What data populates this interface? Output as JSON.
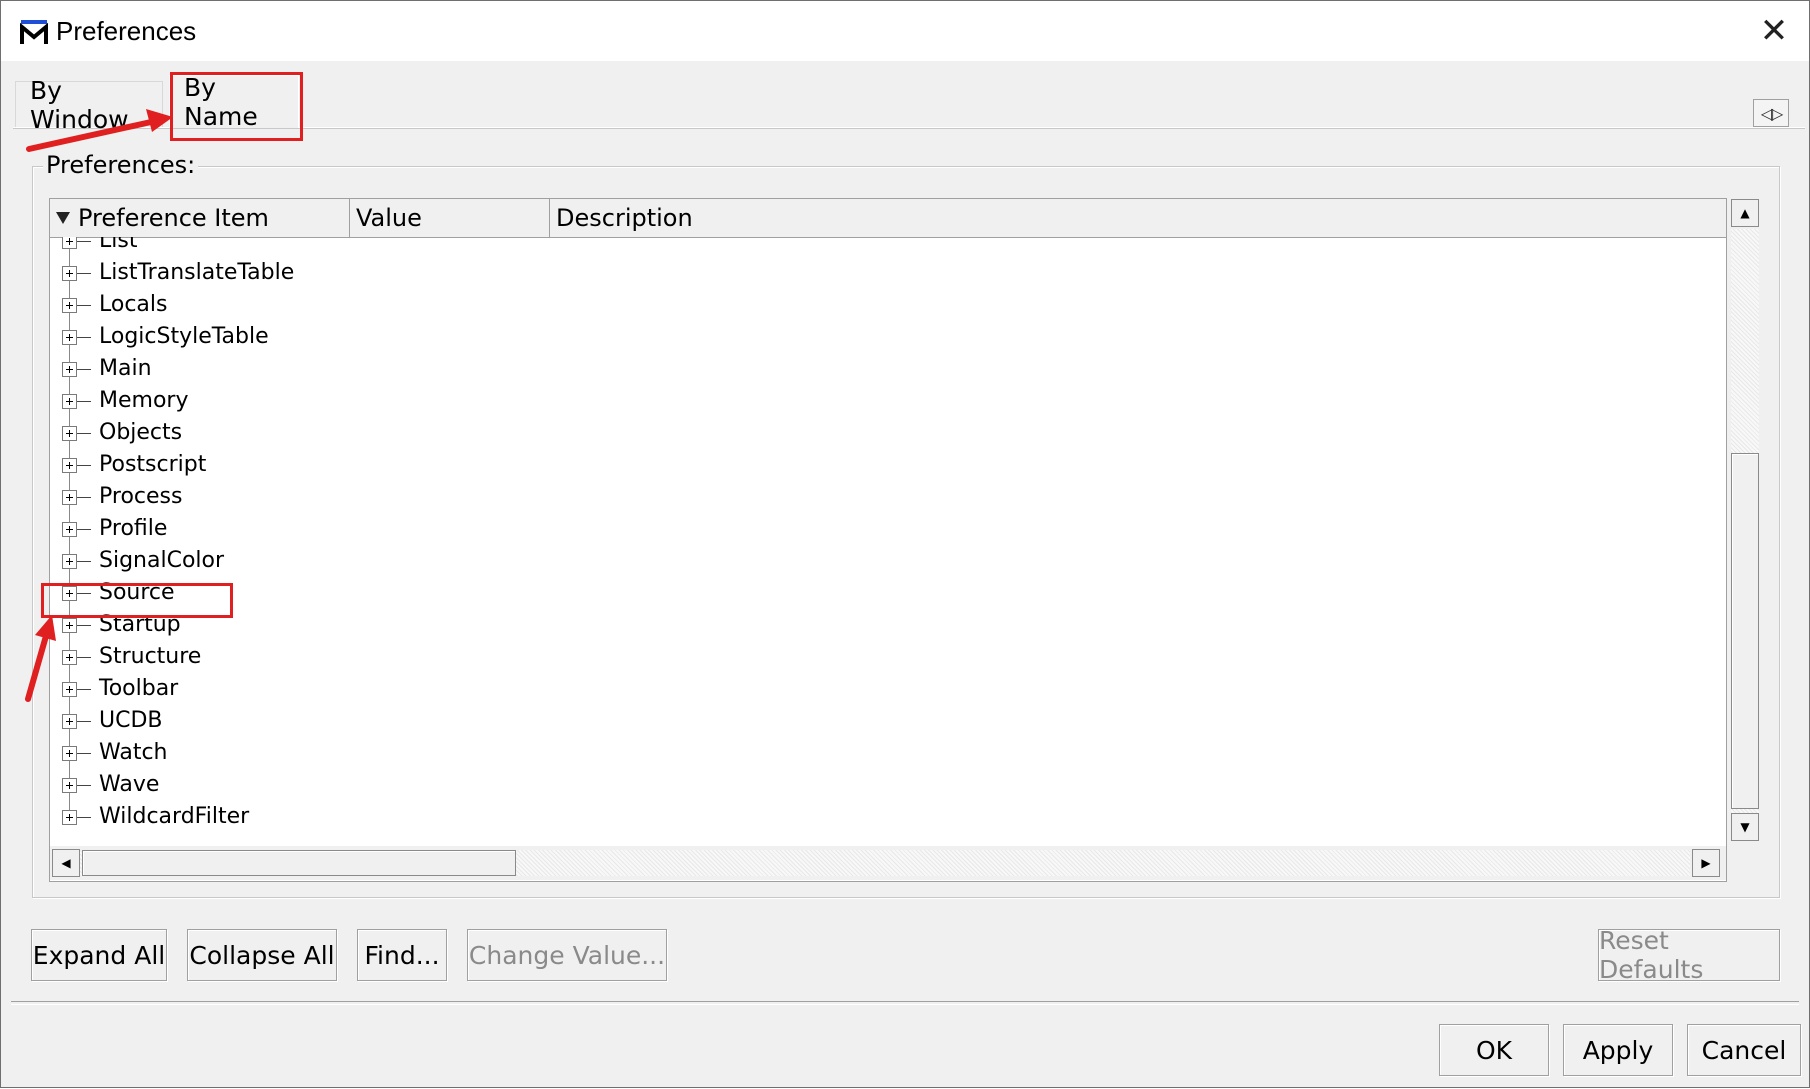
{
  "window": {
    "title": "Preferences"
  },
  "tabs": [
    {
      "label": "By Window"
    },
    {
      "label": "By Name"
    }
  ],
  "group": {
    "label": "Preferences:"
  },
  "columns": {
    "item": "Preference Item",
    "value": "Value",
    "description": "Description"
  },
  "rows": [
    {
      "label": "List"
    },
    {
      "label": "ListTranslateTable"
    },
    {
      "label": "Locals"
    },
    {
      "label": "LogicStyleTable"
    },
    {
      "label": "Main"
    },
    {
      "label": "Memory"
    },
    {
      "label": "Objects"
    },
    {
      "label": "Postscript"
    },
    {
      "label": "Process"
    },
    {
      "label": "Profile"
    },
    {
      "label": "SignalColor"
    },
    {
      "label": "Source"
    },
    {
      "label": "Startup"
    },
    {
      "label": "Structure"
    },
    {
      "label": "Toolbar"
    },
    {
      "label": "UCDB"
    },
    {
      "label": "Watch"
    },
    {
      "label": "Wave"
    },
    {
      "label": "WildcardFilter"
    }
  ],
  "actions": {
    "expand_all": "Expand All",
    "collapse_all": "Collapse All",
    "find": "Find...",
    "change_value": "Change Value...",
    "reset_defaults": "Reset Defaults"
  },
  "footer": {
    "ok": "OK",
    "apply": "Apply",
    "cancel": "Cancel"
  },
  "colors": {
    "annotation": "#e02020",
    "icon_blue": "#1f4fd6"
  },
  "icons": {
    "close": "close-icon",
    "sort": "sort-down-icon",
    "expand": "plus-box-icon"
  }
}
